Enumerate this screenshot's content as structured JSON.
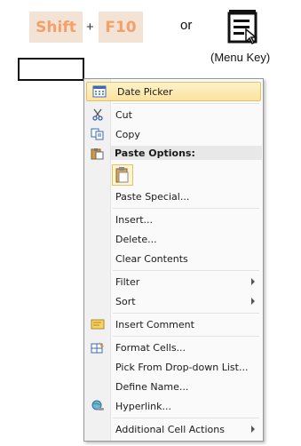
{
  "shortcut": {
    "key1": "Shift",
    "plus": "+",
    "key2": "F10",
    "or": "or",
    "menu_key_label": "(Menu Key)"
  },
  "menu": {
    "date_picker": "Date Picker",
    "cut": "Cut",
    "copy": "Copy",
    "paste_options": "Paste Options:",
    "paste_special": "Paste Special...",
    "insert": "Insert...",
    "delete": "Delete...",
    "clear_contents": "Clear Contents",
    "filter": "Filter",
    "sort": "Sort",
    "insert_comment": "Insert Comment",
    "format_cells": "Format Cells...",
    "pick_from_dropdown": "Pick From Drop-down List...",
    "define_name": "Define Name...",
    "hyperlink": "Hyperlink...",
    "additional_cell_actions": "Additional Cell Actions"
  },
  "colors": {
    "key_bg": "#f2e3d5",
    "key_text": "#f4a06b",
    "highlight": "#fbe3a0"
  }
}
